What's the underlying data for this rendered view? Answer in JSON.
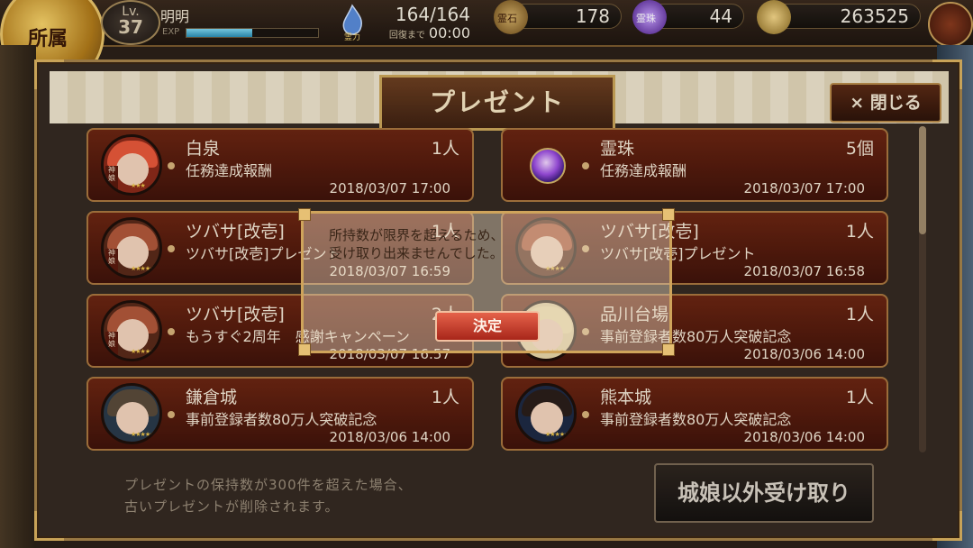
{
  "header": {
    "crest_text": "所属",
    "level_label": "Lv.",
    "level": "37",
    "player_name": "明明",
    "exp_label": "EXP",
    "stamina_label": "霊力",
    "stamina": "164/164",
    "recover_label": "回復まで",
    "recover_time": "00:00",
    "currency1_label": "霊石",
    "currency1": "178",
    "currency2_label": "霊珠",
    "currency2": "44",
    "currency3": "263525"
  },
  "window": {
    "title": "プレゼント",
    "close_label": "× 閉じる"
  },
  "presents": [
    {
      "name": "白泉",
      "qty": "1人",
      "desc": "任務達成報酬",
      "date": "2018/03/07 17:00",
      "badge": "神娘",
      "icon": "castle-girl"
    },
    {
      "name": "霊珠",
      "qty": "5個",
      "desc": "任務達成報酬",
      "date": "2018/03/07 17:00",
      "icon": "spirit-orb"
    },
    {
      "name": "ツバサ[改壱]",
      "qty": "1人",
      "desc": "ツバサ[改壱]プレゼント",
      "date": "2018/03/07 16:59",
      "badge": "神娘",
      "icon": "castle-girl"
    },
    {
      "name": "ツバサ[改壱]",
      "qty": "1人",
      "desc": "ツバサ[改壱]プレゼント",
      "date": "2018/03/07 16:58",
      "icon": "castle-girl"
    },
    {
      "name": "ツバサ[改壱]",
      "qty": "2人",
      "desc": "もうすぐ2周年　感謝キャンペーン",
      "date": "2018/03/07 16:57",
      "badge": "神娘",
      "icon": "castle-girl"
    },
    {
      "name": "品川台場",
      "qty": "1人",
      "desc": "事前登録者数80万人突破記念",
      "date": "2018/03/06 14:00",
      "icon": "castle-girl"
    },
    {
      "name": "鎌倉城",
      "qty": "1人",
      "desc": "事前登録者数80万人突破記念",
      "date": "2018/03/06 14:00",
      "icon": "castle-girl"
    },
    {
      "name": "熊本城",
      "qty": "1人",
      "desc": "事前登録者数80万人突破記念",
      "date": "2018/03/06 14:00",
      "icon": "castle-girl"
    }
  ],
  "footer": {
    "note_line1": "プレゼントの保持数が300件を超えた場合、",
    "note_line2": "古いプレゼントが削除されます。",
    "bulk_button": "城娘以外受け取り"
  },
  "dialog": {
    "message_line1": "所持数が限界を超えるため、",
    "message_line2": "受け取り出来ませんでした。",
    "ok_label": "決定"
  },
  "colors": {
    "card_red": "#6b2512",
    "gold_border": "#cfa45b",
    "ok_button": "#d04a34"
  }
}
